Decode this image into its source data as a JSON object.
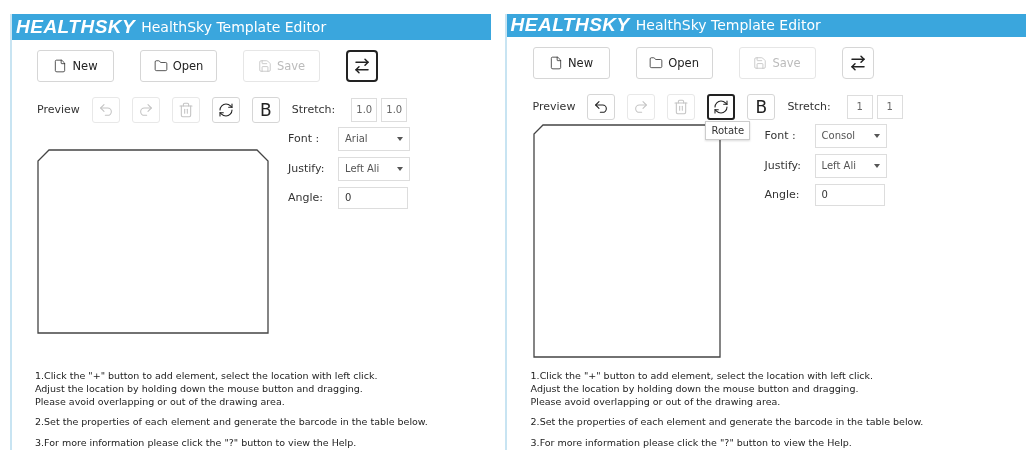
{
  "panels": [
    {
      "canvas_portrait": false,
      "logo": "HEALTHSKY",
      "title": "HealthSky Template Editor",
      "buttons": [
        {
          "kind": "new",
          "label": "New",
          "disabled": false
        },
        {
          "kind": "open",
          "label": "Open",
          "disabled": false
        },
        {
          "kind": "save",
          "label": "Save",
          "disabled": true
        },
        {
          "kind": "swap",
          "focused": true
        }
      ],
      "preview_label": "Preview",
      "tools": [
        {
          "kind": "undo",
          "disabled": true,
          "focused": false
        },
        {
          "kind": "redo",
          "disabled": true,
          "focused": false
        },
        {
          "kind": "delete",
          "disabled": true,
          "focused": false
        },
        {
          "kind": "rotate",
          "disabled": false,
          "focused": false
        },
        {
          "kind": "bold",
          "label": "B",
          "disabled": false,
          "focused": false
        }
      ],
      "stretch": {
        "label": "Stretch:",
        "values": [
          "1.0",
          "1.0"
        ]
      },
      "font": {
        "label": "Font :",
        "value": "Arial"
      },
      "justify": {
        "label": "Justify:",
        "value": "Left Ali"
      },
      "angle": {
        "label": "Angle:",
        "value": "0"
      },
      "instructions": [
        "1.Click the \"+\" button to add element, select the location with left click.\nAdjust the location by holding down the mouse button and dragging.\nPlease avoid overlapping or out of the drawing area.",
        "2.Set the properties of each element and generate the barcode in the table below.",
        "3.For more information please click the \"?\" button to view the Help."
      ]
    },
    {
      "canvas_portrait": true,
      "logo": "HEALTHSKY",
      "title": "HealthSky Template Editor",
      "buttons": [
        {
          "kind": "new",
          "label": "New",
          "disabled": false
        },
        {
          "kind": "open",
          "label": "Open",
          "disabled": false
        },
        {
          "kind": "save",
          "label": "Save",
          "disabled": true
        },
        {
          "kind": "swap",
          "focused": false
        }
      ],
      "preview_label": "Preview",
      "tools": [
        {
          "kind": "undo",
          "disabled": false,
          "focused": false
        },
        {
          "kind": "redo",
          "disabled": true,
          "focused": false
        },
        {
          "kind": "delete",
          "disabled": true,
          "focused": false
        },
        {
          "kind": "rotate",
          "disabled": false,
          "focused": true,
          "tooltip": "Rotate"
        },
        {
          "kind": "bold",
          "label": "B",
          "disabled": false,
          "focused": false
        }
      ],
      "stretch": {
        "label": "Stretch:",
        "values": [
          "1",
          "1"
        ]
      },
      "font": {
        "label": "Font :",
        "value": "Consol"
      },
      "justify": {
        "label": "Justify:",
        "value": "Left Ali"
      },
      "angle": {
        "label": "Angle:",
        "value": "0"
      },
      "instructions": [
        "1.Click the \"+\" button to add element, select the location with left click.\nAdjust the location by holding down the mouse button and dragging.\nPlease avoid overlapping or out of the drawing area.",
        "2.Set the properties of each element and generate the barcode in the table below.",
        "3.For more information please click the \"?\" button to view the Help."
      ]
    }
  ]
}
